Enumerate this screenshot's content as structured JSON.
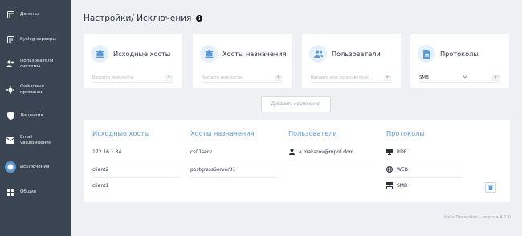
{
  "sidebar": {
    "items": [
      {
        "label": "Домены",
        "icon": "domains-icon"
      },
      {
        "label": "Syslog серверы",
        "icon": "syslog-icon"
      },
      {
        "label": "Пользователи\nсистемы",
        "icon": "users-icon"
      },
      {
        "label": "Файловые\nприманки",
        "icon": "file-lure-icon"
      },
      {
        "label": "Лицензия",
        "icon": "license-icon"
      },
      {
        "label": "Email\nуведомления",
        "icon": "email-icon"
      },
      {
        "label": "Исключения",
        "icon": "exclusions-icon"
      },
      {
        "label": "Общие",
        "icon": "general-icon"
      }
    ],
    "active_index": 6
  },
  "header": {
    "title": "Настройки/ Исключения",
    "info_glyph": "i"
  },
  "filters": {
    "source_hosts": {
      "title": "Исходные хосты",
      "placeholder": "Введите имя хоста",
      "add_glyph": "+"
    },
    "dest_hosts": {
      "title": "Хосты назначения",
      "placeholder": "Введите имя хоста",
      "add_glyph": "+"
    },
    "users": {
      "title": "Пользователи",
      "placeholder": "Введите имя пользователя",
      "add_glyph": "+"
    },
    "protocols": {
      "title": "Протоколы",
      "selected": "SMB",
      "add_glyph": "+"
    }
  },
  "add_exclusion_label": "Добавить исключения",
  "table": {
    "headers": {
      "source_hosts": "Исходные хосты",
      "dest_hosts": "Хосты назначения",
      "users": "Пользователи",
      "protocols": "Протоколы"
    },
    "source_hosts": [
      "172.16.1.34",
      "client2",
      "client1"
    ],
    "dest_hosts": [
      "cs01serv",
      "postgressServer01"
    ],
    "users": [
      "a.makarov@mpot.dom"
    ],
    "protocols": [
      {
        "name": "RDP",
        "icon": "monitor-icon"
      },
      {
        "name": "WEB",
        "icon": "globe-icon"
      },
      {
        "name": "SMB",
        "icon": "network-icon"
      }
    ]
  },
  "footer": "Xello Deception – версия 4.2.0",
  "colors": {
    "sidebar_bg": "#3b4452",
    "accent": "#5b9bd5",
    "page_bg": "#eef0f3"
  }
}
